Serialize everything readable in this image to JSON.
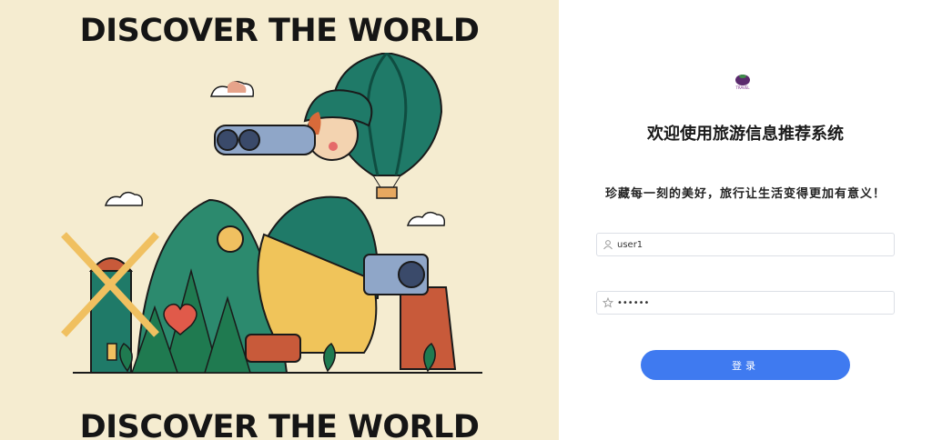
{
  "left_panel": {
    "headline_top": "DISCOVER THE WORLD",
    "headline_bottom": "DISCOVER THE WORLD",
    "illustration": "traveler-with-binoculars-illustration",
    "background": "#f5ecd0"
  },
  "logo": {
    "icon": "mangosteen-logo-icon",
    "caption": "TRAVEL"
  },
  "login": {
    "title": "欢迎使用旅游信息推荐系统",
    "slogan": "珍藏每一刻的美好，旅行让生活变得更加有意义！",
    "username": {
      "value": "user1",
      "icon": "user-icon"
    },
    "password": {
      "value": "123456",
      "icon": "star-icon"
    },
    "submit_label": "登录"
  },
  "colors": {
    "accent": "#3f7af0",
    "border": "#dcdfe6"
  }
}
